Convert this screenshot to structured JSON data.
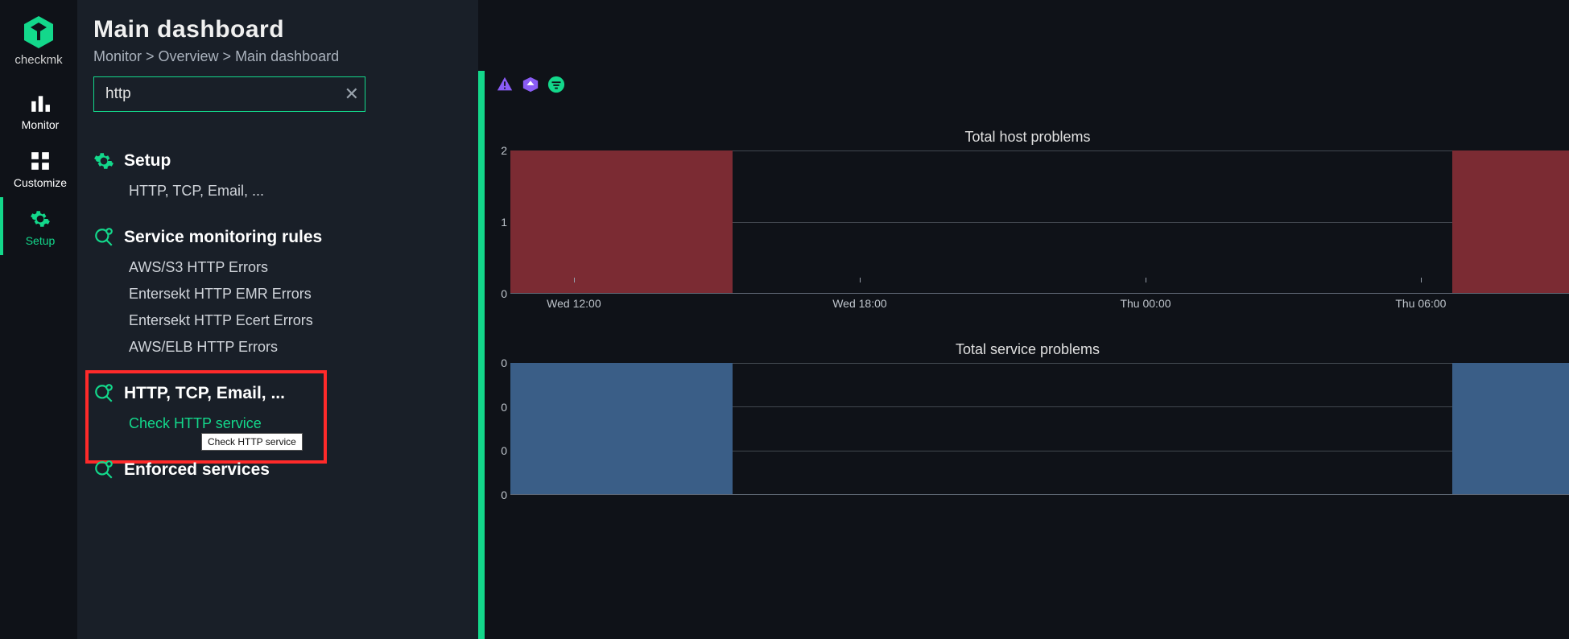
{
  "brand": {
    "name": "checkmk"
  },
  "nav": {
    "monitor": "Monitor",
    "customize": "Customize",
    "setup": "Setup"
  },
  "header": {
    "title": "Main dashboard",
    "breadcrumb": "Monitor > Overview > Main dashboard"
  },
  "search": {
    "value": "http"
  },
  "results": {
    "groups": [
      {
        "icon": "gear",
        "title": "Setup",
        "items": [
          {
            "label": "HTTP, TCP, Email, ...",
            "link": false
          }
        ]
      },
      {
        "icon": "magnify-plus",
        "title": "Service monitoring rules",
        "items": [
          {
            "label": "AWS/S3 HTTP Errors",
            "link": false
          },
          {
            "label": "Entersekt HTTP EMR Errors",
            "link": false
          },
          {
            "label": "Entersekt HTTP Ecert Errors",
            "link": false
          },
          {
            "label": "AWS/ELB HTTP Errors",
            "link": false
          }
        ]
      },
      {
        "icon": "magnify-plus",
        "title": "HTTP, TCP, Email, ...",
        "items": [
          {
            "label": "Check HTTP service",
            "link": true,
            "tooltip": "Check HTTP service"
          }
        ],
        "highlighted": true
      },
      {
        "icon": "magnify-plus",
        "title": "Enforced services",
        "items": []
      }
    ]
  },
  "chart_data": [
    {
      "type": "bar",
      "title": "Total host problems",
      "y_ticks": [
        0,
        1,
        2
      ],
      "ylim": [
        0,
        2
      ],
      "x_ticks": [
        "Wed 12:00",
        "Wed 18:00",
        "Thu 00:00",
        "Thu 06:00"
      ],
      "x_tick_positions_pct": [
        6,
        33,
        60,
        86
      ],
      "color": "red",
      "bars": [
        {
          "left_pct": 0,
          "width_pct": 21,
          "value": 2
        },
        {
          "left_pct": 89,
          "width_pct": 11,
          "value": 2
        }
      ]
    },
    {
      "type": "bar",
      "title": "Total service problems",
      "y_ticks": [
        0,
        0,
        0,
        0
      ],
      "ylim": [
        0,
        3
      ],
      "x_ticks": [],
      "x_tick_positions_pct": [],
      "color": "blue",
      "bars": [
        {
          "left_pct": 0,
          "width_pct": 21,
          "value": 3
        },
        {
          "left_pct": 89,
          "width_pct": 11,
          "value": 3
        }
      ]
    }
  ]
}
